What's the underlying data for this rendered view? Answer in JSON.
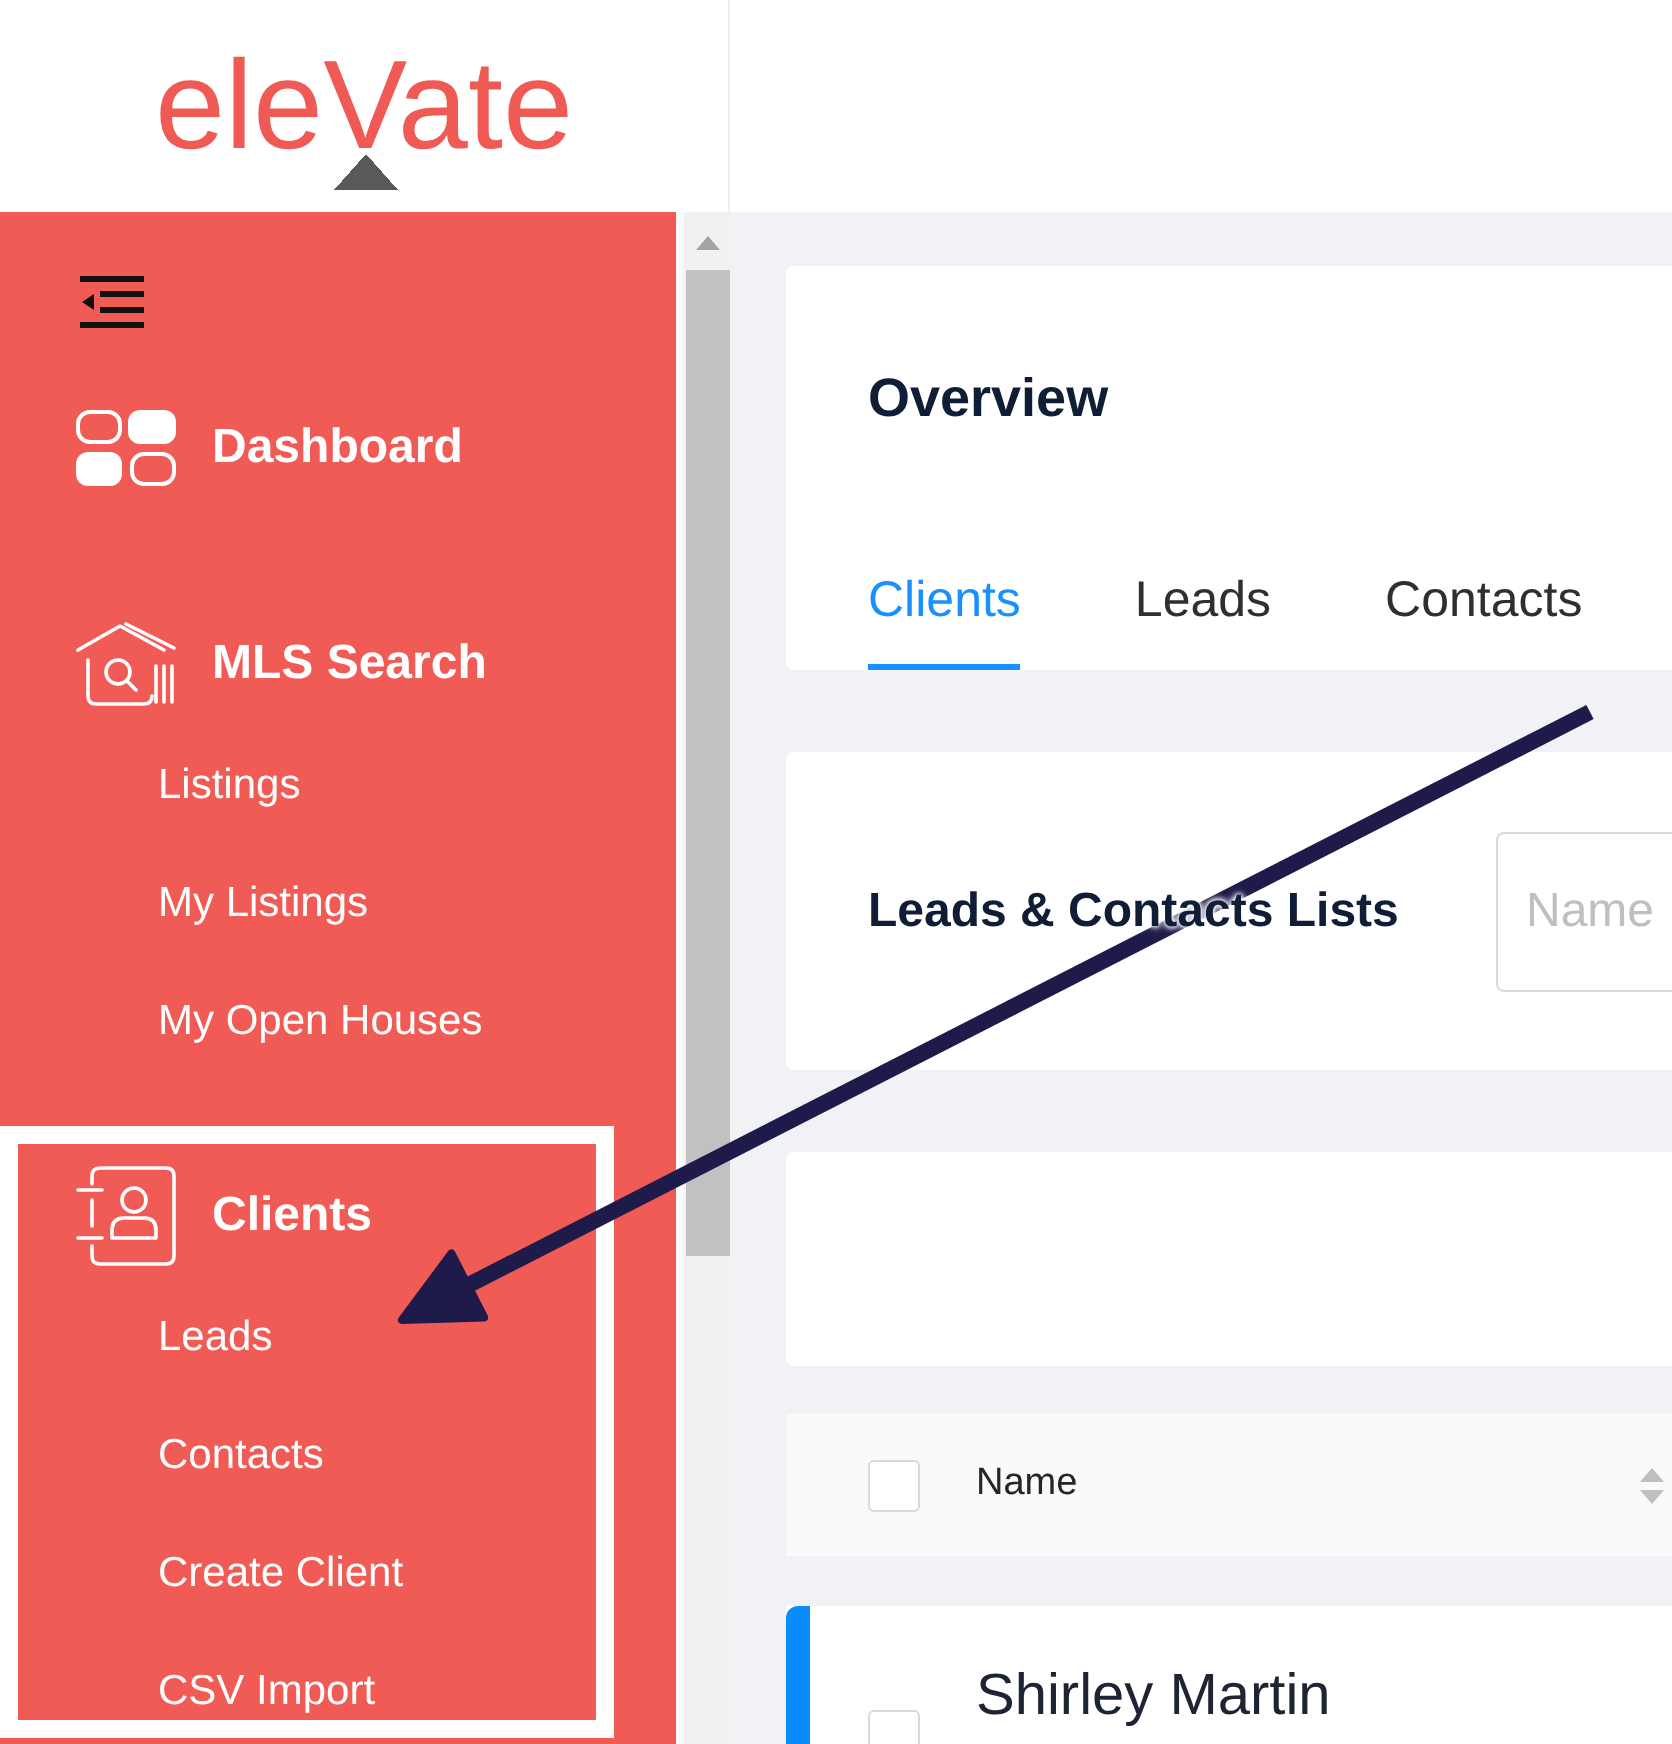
{
  "logo": {
    "text": "eleVate"
  },
  "sidebar": {
    "items": [
      {
        "label": "Dashboard",
        "highlighted": false
      },
      {
        "label": "MLS Search",
        "highlighted": false,
        "children": [
          {
            "label": "Listings"
          },
          {
            "label": "My Listings"
          },
          {
            "label": "My Open Houses"
          }
        ]
      },
      {
        "label": "Clients",
        "highlighted": true,
        "children": [
          {
            "label": "Leads"
          },
          {
            "label": "Contacts"
          },
          {
            "label": "Create Client"
          },
          {
            "label": "CSV Import"
          }
        ]
      }
    ]
  },
  "overview": {
    "title": "Overview",
    "tabs": [
      {
        "label": "Clients",
        "selected": true
      },
      {
        "label": "Leads",
        "selected": false
      },
      {
        "label": "Contacts",
        "selected": false
      }
    ]
  },
  "lists_panel": {
    "title": "Leads & Contacts Lists",
    "search": {
      "placeholder": "Name"
    }
  },
  "table": {
    "header_checkbox": {
      "checked": false
    },
    "columns": [
      {
        "label": "Name"
      }
    ],
    "rows": [
      {
        "name": "Shirley Martin",
        "checked": false,
        "color": "#0a8cff"
      }
    ]
  }
}
